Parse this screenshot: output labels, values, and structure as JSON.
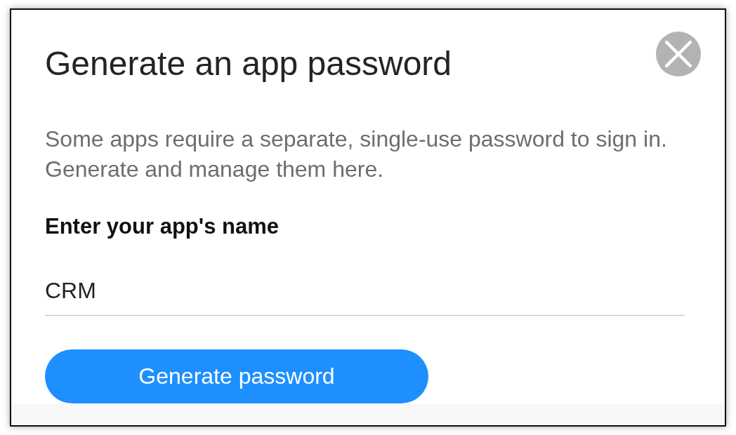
{
  "dialog": {
    "title": "Generate an app password",
    "closable": true,
    "description": "Some apps require a separate, single-use password to sign in. Generate and manage them here.",
    "field": {
      "label": "Enter your app's name",
      "value": "CRM"
    },
    "primary_button": "Generate password"
  }
}
